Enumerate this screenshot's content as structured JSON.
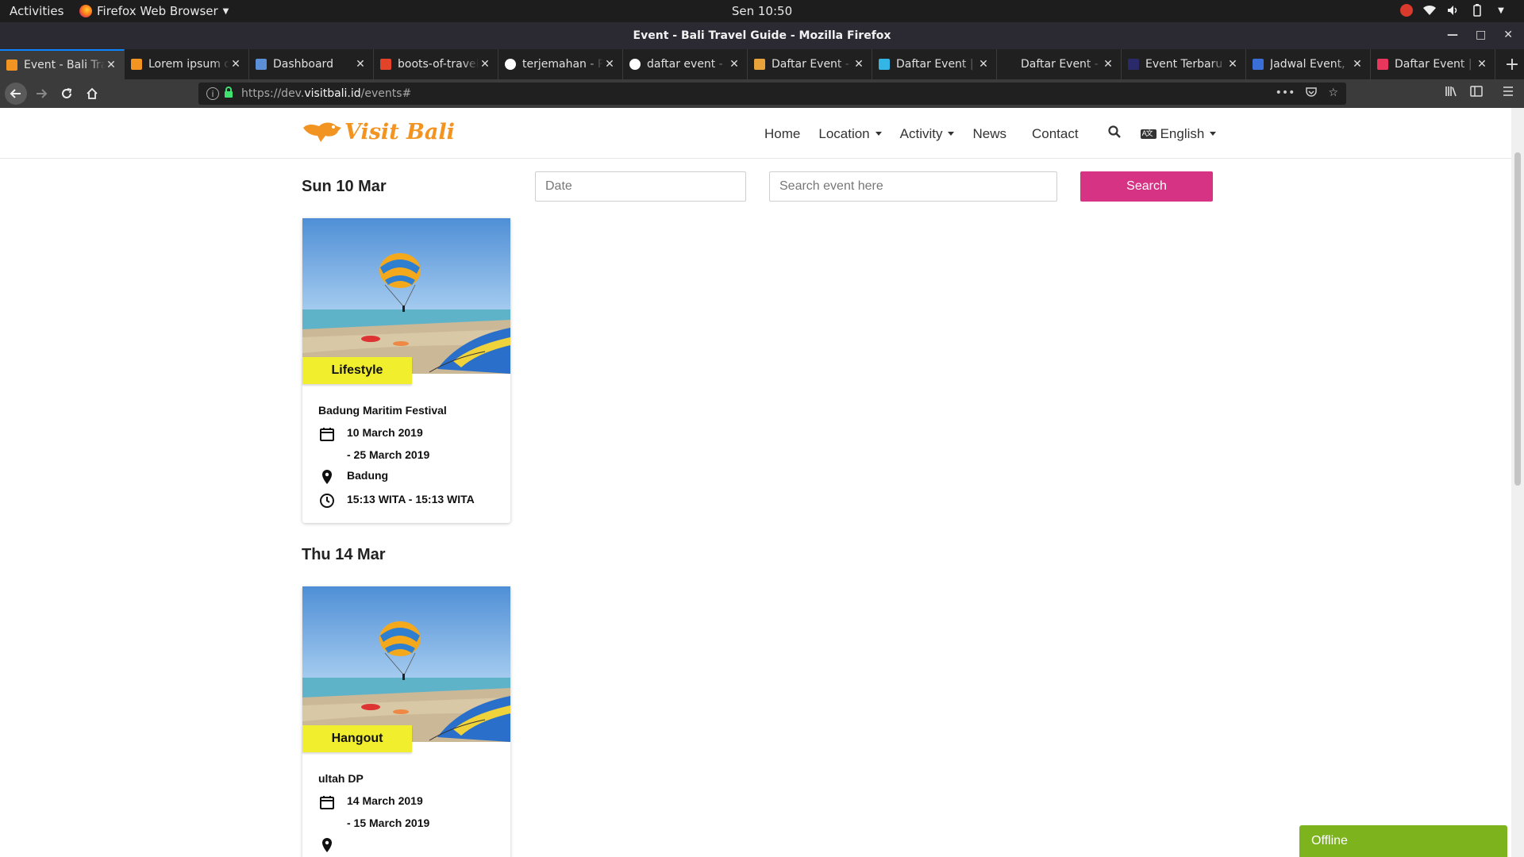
{
  "system": {
    "activities": "Activities",
    "app_name": "Firefox Web Browser",
    "clock": "Sen 10:50"
  },
  "window": {
    "title": "Event - Bali Travel Guide - Mozilla Firefox"
  },
  "tabs": [
    {
      "label": "Event - Bali Travel Guide",
      "favicon_color": "#f29422",
      "active": true
    },
    {
      "label": "Lorem ipsum dolor",
      "favicon_color": "#f29422",
      "active": false
    },
    {
      "label": "Dashboard",
      "favicon_color": "#5b8fd8",
      "active": false
    },
    {
      "label": "boots-of-travel",
      "favicon_color": "#e24329",
      "active": false
    },
    {
      "label": "terjemahan - Penelusuran",
      "favicon_color": "#ffffff",
      "active": false
    },
    {
      "label": "daftar event - Penelusuran",
      "favicon_color": "#ffffff",
      "active": false
    },
    {
      "label": "Daftar Event - ",
      "favicon_color": "#e8a33a",
      "active": false
    },
    {
      "label": "Daftar Event | ",
      "favicon_color": "#33b5e5",
      "active": false
    },
    {
      "label": "Daftar Event - Event",
      "favicon_color": "#202020",
      "active": false
    },
    {
      "label": "Event Terbaru",
      "favicon_color": "#2a2a6a",
      "active": false
    },
    {
      "label": "Jadwal Event, ",
      "favicon_color": "#3b6fd8",
      "active": false
    },
    {
      "label": "Daftar Event | ",
      "favicon_color": "#e8365d",
      "active": false
    }
  ],
  "urlbar": {
    "prefix": "https://dev.",
    "domain": "visitbali.id",
    "path": "/events#"
  },
  "site": {
    "logo_text": "Visit Bali",
    "nav": {
      "home": "Home",
      "location": "Location",
      "activity": "Activity",
      "news": "News",
      "contact": "Contact",
      "language": "English"
    },
    "filter": {
      "date_placeholder": "Date",
      "search_placeholder": "Search event here",
      "search_button": "Search"
    }
  },
  "events": [
    {
      "date_heading": "Sun 10 Mar",
      "category": "Lifestyle",
      "title": "Badung Maritim Festival",
      "start_date": "10 March 2019",
      "end_date": "- 25 March 2019",
      "location": "Badung",
      "time": "15:13 WITA - 15:13 WITA"
    },
    {
      "date_heading": "Thu 14 Mar",
      "category": "Hangout",
      "title": "ultah DP",
      "start_date": "14 March 2019",
      "end_date": "- 15 March 2019",
      "location": "",
      "time": ""
    }
  ],
  "chat_widget": {
    "status": "Offline"
  },
  "colors": {
    "accent_pink": "#d63384",
    "category_yellow": "#f1ee2d",
    "offline_green": "#7db41e",
    "logo_orange": "#f29422"
  }
}
